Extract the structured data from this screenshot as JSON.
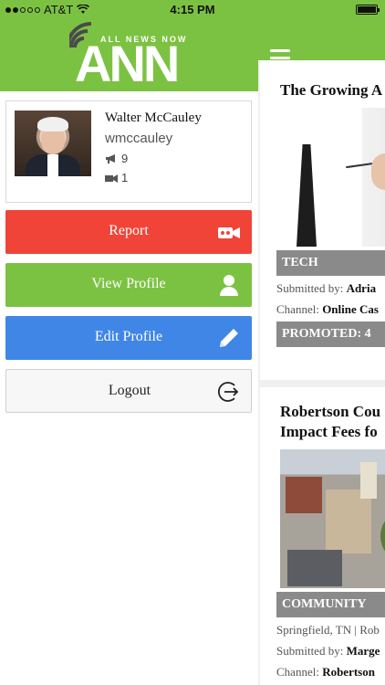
{
  "status_bar": {
    "carrier": "AT&T",
    "time": "4:15 PM",
    "battery_level": 0.9
  },
  "header": {
    "logo_tagline": "ALL NEWS NOW",
    "logo_text": "ANN",
    "menu_icon": "hamburger-menu-icon"
  },
  "profile": {
    "name": "Walter McCauley",
    "username": "wmccauley",
    "reports_count": "9",
    "videos_count": "1",
    "reports_icon": "megaphone-icon",
    "videos_icon": "video-camera-icon"
  },
  "buttons": {
    "report": "Report",
    "view_profile": "View Profile",
    "edit_profile": "Edit Profile",
    "logout": "Logout"
  },
  "feed": {
    "cards": [
      {
        "title": "The Growing A",
        "tag": "TECH",
        "submitted_prefix": "Submitted by: ",
        "submitted_by": "Adria",
        "channel_prefix": "Channel: ",
        "channel": "Online Cas",
        "promoted": "PROMOTED: 4"
      },
      {
        "title_line1": "Robertson Cou",
        "title_line2": "Impact Fees fo",
        "tag": "COMMUNITY",
        "location": "Springfield, TN | Rob",
        "submitted_prefix": "Submitted by: ",
        "submitted_by": "Marge",
        "channel_prefix": "Channel: ",
        "channel": "Robertson"
      }
    ]
  },
  "colors": {
    "header_green": "#7cc242",
    "report_red": "#f04438",
    "view_green": "#7cc242",
    "edit_blue": "#3f86e6",
    "tag_gray": "#8a8a8a"
  }
}
